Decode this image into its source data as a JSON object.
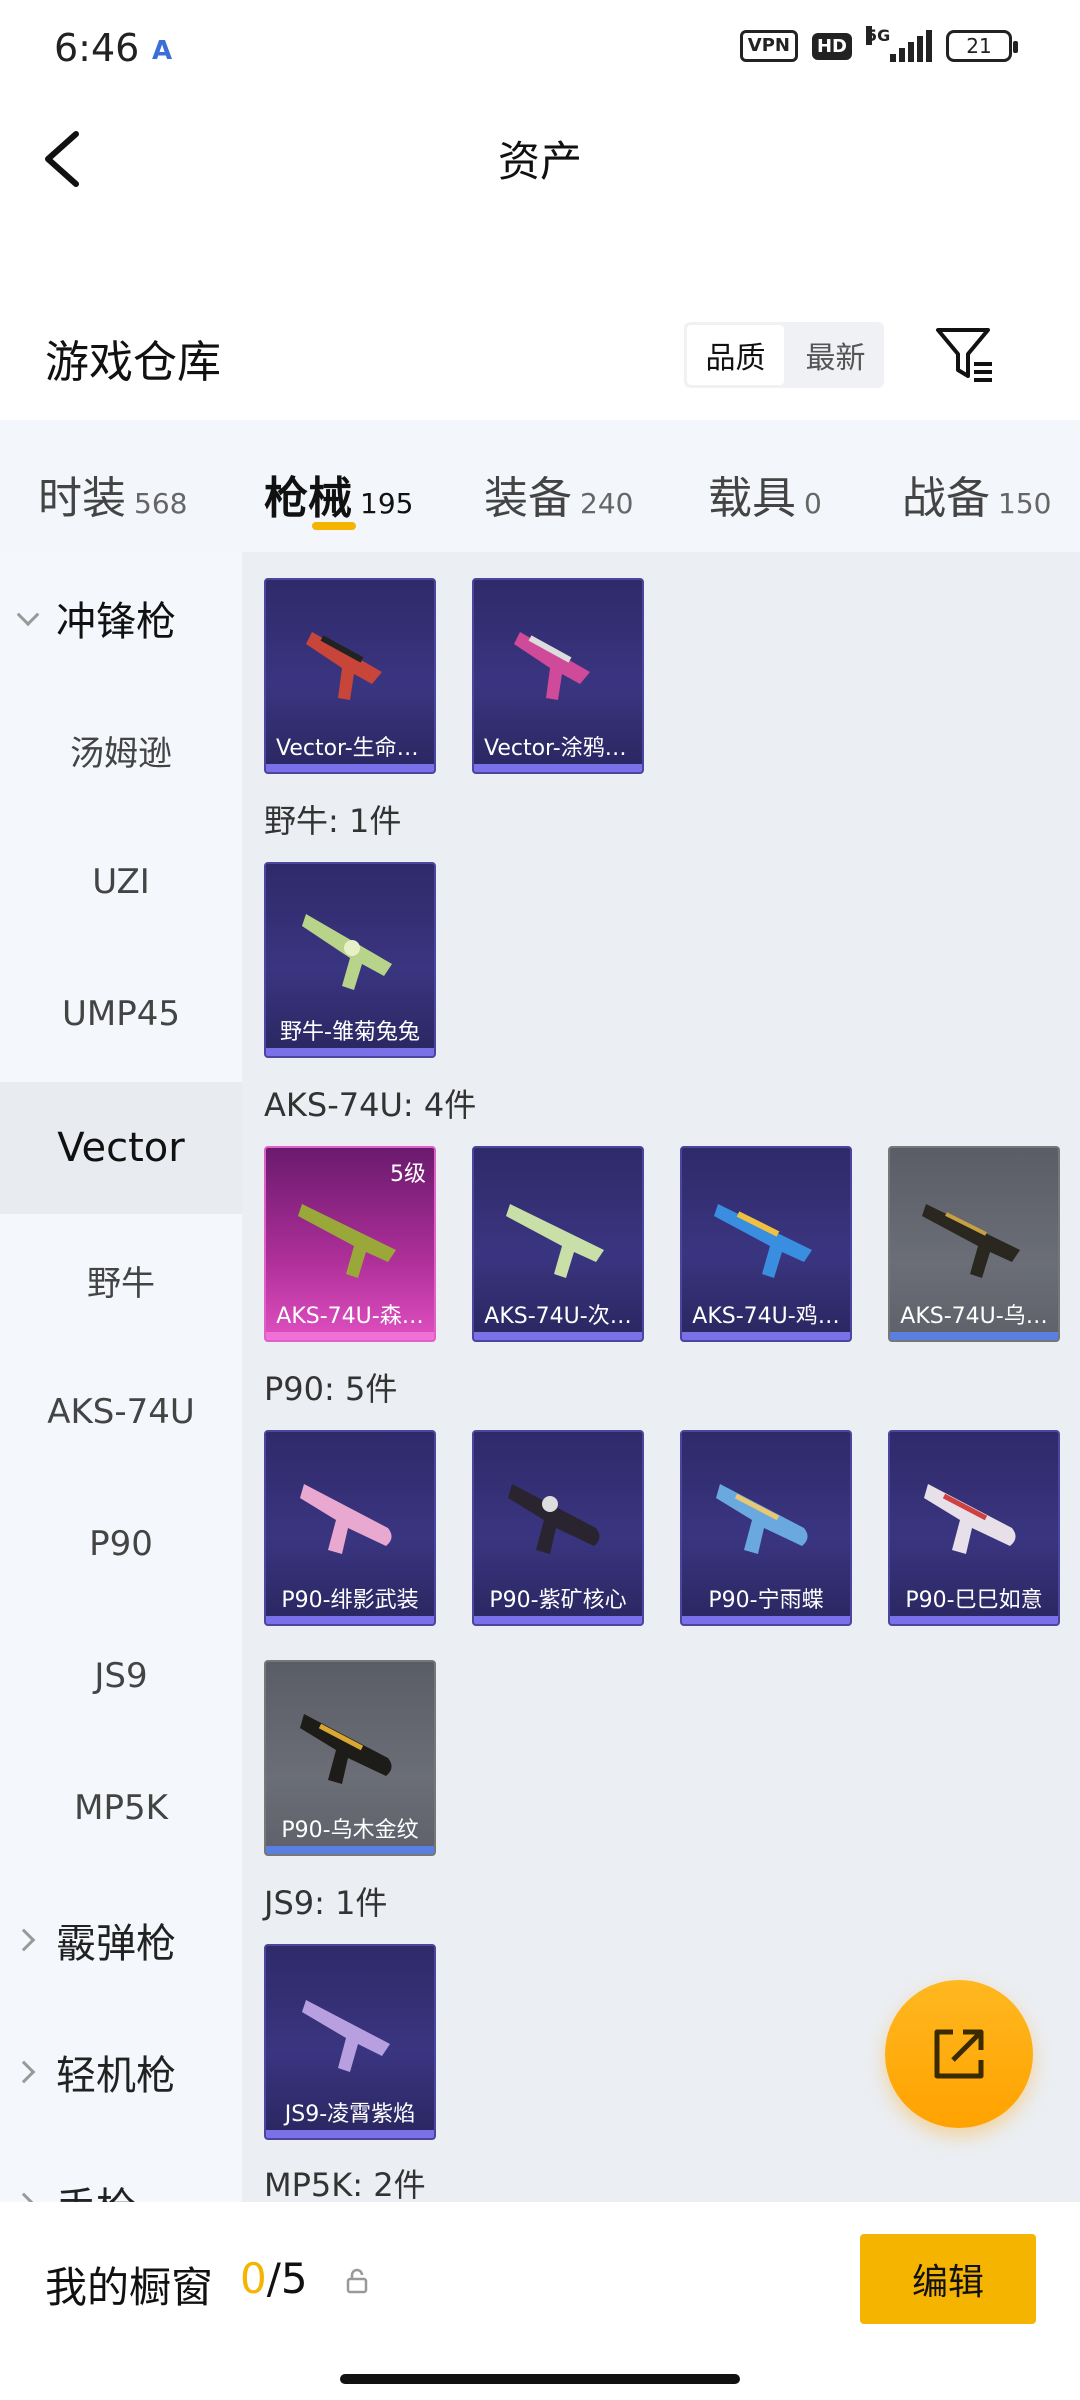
{
  "status_bar": {
    "time": "6:46",
    "vpn": "VPN",
    "hd": "HD",
    "network": "5G",
    "battery": "21"
  },
  "header": {
    "title": "资产"
  },
  "warehouse": {
    "title": "游戏仓库",
    "sort_quality": "品质",
    "sort_newest": "最新"
  },
  "tabs": [
    {
      "label": "时装",
      "count": "568"
    },
    {
      "label": "枪械",
      "count": "195"
    },
    {
      "label": "装备",
      "count": "240"
    },
    {
      "label": "载具",
      "count": "0"
    },
    {
      "label": "战备",
      "count": "150"
    }
  ],
  "sidebar": {
    "group_smg": "冲锋枪",
    "items": [
      "汤姆逊",
      "UZI",
      "UMP45",
      "Vector",
      "野牛",
      "AKS-74U",
      "P90",
      "JS9",
      "MP5K"
    ],
    "group_shotgun": "霰弹枪",
    "group_lmg": "轻机枪",
    "group_pistol": "手枪"
  },
  "sections": {
    "bison": "野牛: 1件",
    "aks": "AKS-74U: 4件",
    "p90": "P90: 5件",
    "js9": "JS9: 1件",
    "mp5k": "MP5K: 2件"
  },
  "cards": {
    "vector_1": "Vector-生命之种",
    "vector_2": "Vector-涂鸦狂想",
    "bison_1": "野牛-雏菊兔兔",
    "aks_1": "AKS-74U-森…",
    "aks_1_level": "5级",
    "aks_2": "AKS-74U-次…",
    "aks_3": "AKS-74U-鸡…",
    "aks_4": "AKS-74U-乌…",
    "p90_1": "P90-绯影武装",
    "p90_2": "P90-紫矿核心",
    "p90_3": "P90-宁雨蝶",
    "p90_4": "P90-巳巳如意",
    "p90_5": "P90-乌木金纹",
    "js9_1": "JS9-凌霄紫焰"
  },
  "bottom_bar": {
    "title": "我的橱窗",
    "current": "0",
    "total": "/5",
    "edit": "编辑"
  },
  "colors": {
    "accent": "#f5b400",
    "card_purple": "#3a3580",
    "card_pink": "#b0309a",
    "card_gray": "#6b6e77"
  }
}
